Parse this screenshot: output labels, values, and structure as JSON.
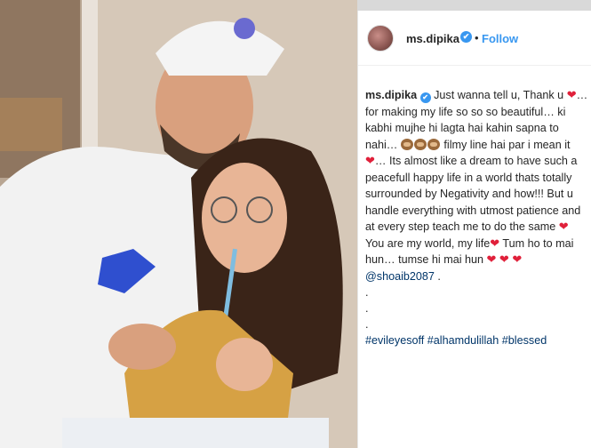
{
  "post": {
    "username": "ms.dipika",
    "verified_mark": "✔",
    "dot": "•",
    "follow_label": "Follow"
  },
  "caption": {
    "username": "ms.dipika",
    "text_1": " Just wanna tell u, Thank u ",
    "text_2": "… for making my life so so so beautiful… ki kabhi mujhe hi lagta hai kahin sapna to nahi… ",
    "text_3": " filmy line hai par i mean it ",
    "text_4": "… Its almost like a dream to have such a peacefull happy life in a world thats totally surrounded by Negativity and how!!! But u handle everything with utmost patience and at every step teach me to do the same ",
    "text_5": " You are my world, my life",
    "text_6": " Tum ho to mai hun… tumse hi mai hun ",
    "mention": "@shoaib2087",
    "after_mention": " .",
    "dots": [
      ".",
      ".",
      "."
    ],
    "hashtags": "#evileyesoff #alhamdulillah #blessed",
    "heart": "❤"
  },
  "icons": {
    "verified": "verified-badge-icon",
    "heart": "heart-icon",
    "monkey": "see-no-evil-monkey-icon"
  },
  "colors": {
    "link": "#3897f0",
    "hashtag": "#003569",
    "heart": "#e0203a"
  }
}
